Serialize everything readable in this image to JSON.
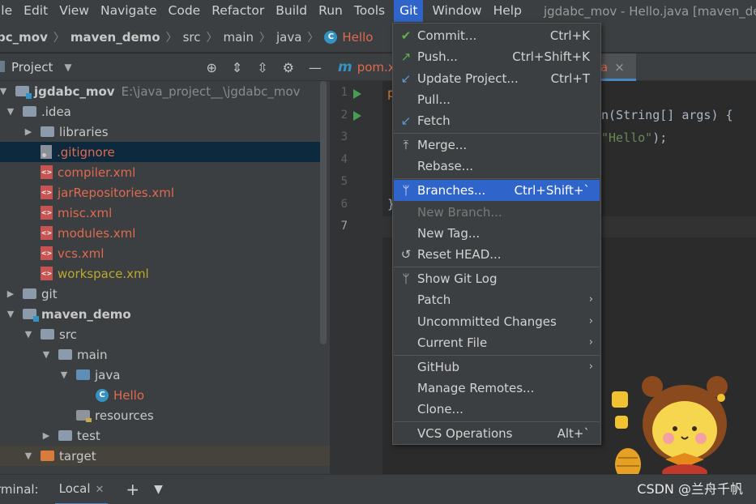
{
  "menubar": {
    "items": [
      "ile",
      "Edit",
      "View",
      "Navigate",
      "Code",
      "Refactor",
      "Build",
      "Run",
      "Tools",
      "Git",
      "Window",
      "Help"
    ],
    "window_title": "jgdabc_mov - Hello.java [maven_der"
  },
  "breadcrumb": {
    "items": [
      "bc_mov",
      "maven_demo",
      "src",
      "main",
      "java",
      "Hello"
    ]
  },
  "project_panel": {
    "title": "Project",
    "tree": [
      {
        "label": "jgdabc_mov",
        "path": "E:\\java_project__\\jgdabc_mov"
      },
      {
        "label": ".idea"
      },
      {
        "label": "libraries"
      },
      {
        "label": ".gitignore"
      },
      {
        "label": "compiler.xml"
      },
      {
        "label": "jarRepositories.xml"
      },
      {
        "label": "misc.xml"
      },
      {
        "label": "modules.xml"
      },
      {
        "label": "vcs.xml"
      },
      {
        "label": "workspace.xml"
      },
      {
        "label": "git"
      },
      {
        "label": "maven_demo"
      },
      {
        "label": "src"
      },
      {
        "label": "main"
      },
      {
        "label": "java"
      },
      {
        "label": "Hello"
      },
      {
        "label": "resources"
      },
      {
        "label": "test"
      },
      {
        "label": "target"
      }
    ]
  },
  "editor": {
    "tabs": [
      {
        "label": "pom.x",
        "icon": "m"
      },
      {
        "label": "a",
        "close": "×"
      }
    ],
    "line_numbers": [
      "1",
      "2",
      "3",
      "4",
      "5",
      "6",
      "7"
    ],
    "code": {
      "line1": "p",
      "line2_part": "n(String[] args) {",
      "line3_str": "\"Hello\"",
      "line3_end": ");",
      "line6": "}"
    }
  },
  "git_menu": {
    "items": [
      {
        "label": "Commit...",
        "shortcut": "Ctrl+K",
        "icon": "check-icon"
      },
      {
        "label": "Push...",
        "shortcut": "Ctrl+Shift+K",
        "icon": "push-arrow-icon"
      },
      {
        "label": "Update Project...",
        "shortcut": "Ctrl+T",
        "icon": "update-arrow-icon"
      },
      {
        "label": "Pull...",
        "shortcut": ""
      },
      {
        "label": "Fetch",
        "shortcut": "",
        "icon": "fetch-arrow-icon"
      },
      {
        "label": "Merge...",
        "shortcut": "",
        "icon": "merge-icon"
      },
      {
        "label": "Rebase...",
        "shortcut": ""
      },
      {
        "label": "Branches...",
        "shortcut": "Ctrl+Shift+`",
        "icon": "branch-icon"
      },
      {
        "label": "New Branch...",
        "shortcut": ""
      },
      {
        "label": "New Tag...",
        "shortcut": ""
      },
      {
        "label": "Reset HEAD...",
        "shortcut": "",
        "icon": "reset-icon"
      },
      {
        "label": "Show Git Log",
        "shortcut": "",
        "icon": "branch-icon"
      },
      {
        "label": "Patch",
        "submenu": "›"
      },
      {
        "label": "Uncommitted Changes",
        "submenu": "›"
      },
      {
        "label": "Current File",
        "submenu": "›"
      },
      {
        "label": "GitHub",
        "submenu": "›"
      },
      {
        "label": "Manage Remotes...",
        "shortcut": ""
      },
      {
        "label": "Clone...",
        "shortcut": ""
      },
      {
        "label": "VCS Operations",
        "shortcut": "Alt+`"
      }
    ]
  },
  "terminal": {
    "label": "rminal:",
    "tab": "Local"
  },
  "watermark": "CSDN @兰舟千帆",
  "colors": {
    "accent": "#2f65ca",
    "panel_bg": "#3c3f41",
    "editor_bg": "#2b2b2b",
    "untracked_red": "#e0694e",
    "ignored_olive": "#bba92e"
  }
}
